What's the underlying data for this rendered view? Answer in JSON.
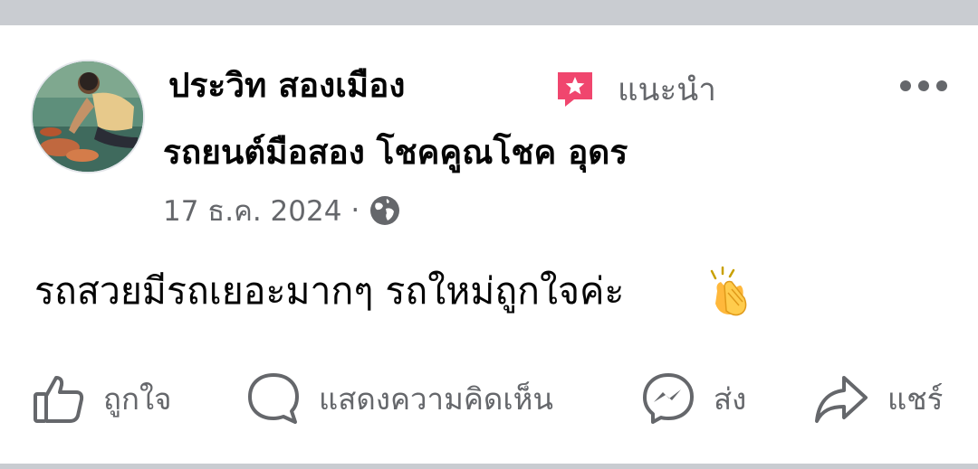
{
  "post": {
    "author": "ประวิท สองเมือง",
    "badge_label": "แนะนำ",
    "group": "รถยนต์มือสอง โชคคูณโชค อุดร",
    "date": "17 ธ.ค. 2024",
    "meta_separator": "·",
    "privacy_icon": "globe-icon",
    "text": "รถสวยมีรถเยอะมากๆ รถใหม่ถูกใจค่ะ",
    "emoji": "clapping-hands"
  },
  "actions": [
    {
      "label": "ถูกใจ",
      "icon": "like-icon"
    },
    {
      "label": "แสดงความคิดเห็น",
      "icon": "comment-icon"
    },
    {
      "label": "ส่ง",
      "icon": "messenger-icon"
    },
    {
      "label": "แชร์",
      "icon": "share-icon"
    }
  ],
  "colors": {
    "page_bg": "#c9ccd1",
    "card_bg": "#ffffff",
    "text_primary": "#050505",
    "text_secondary": "#65676b",
    "badge_pink": "#f0466e"
  }
}
